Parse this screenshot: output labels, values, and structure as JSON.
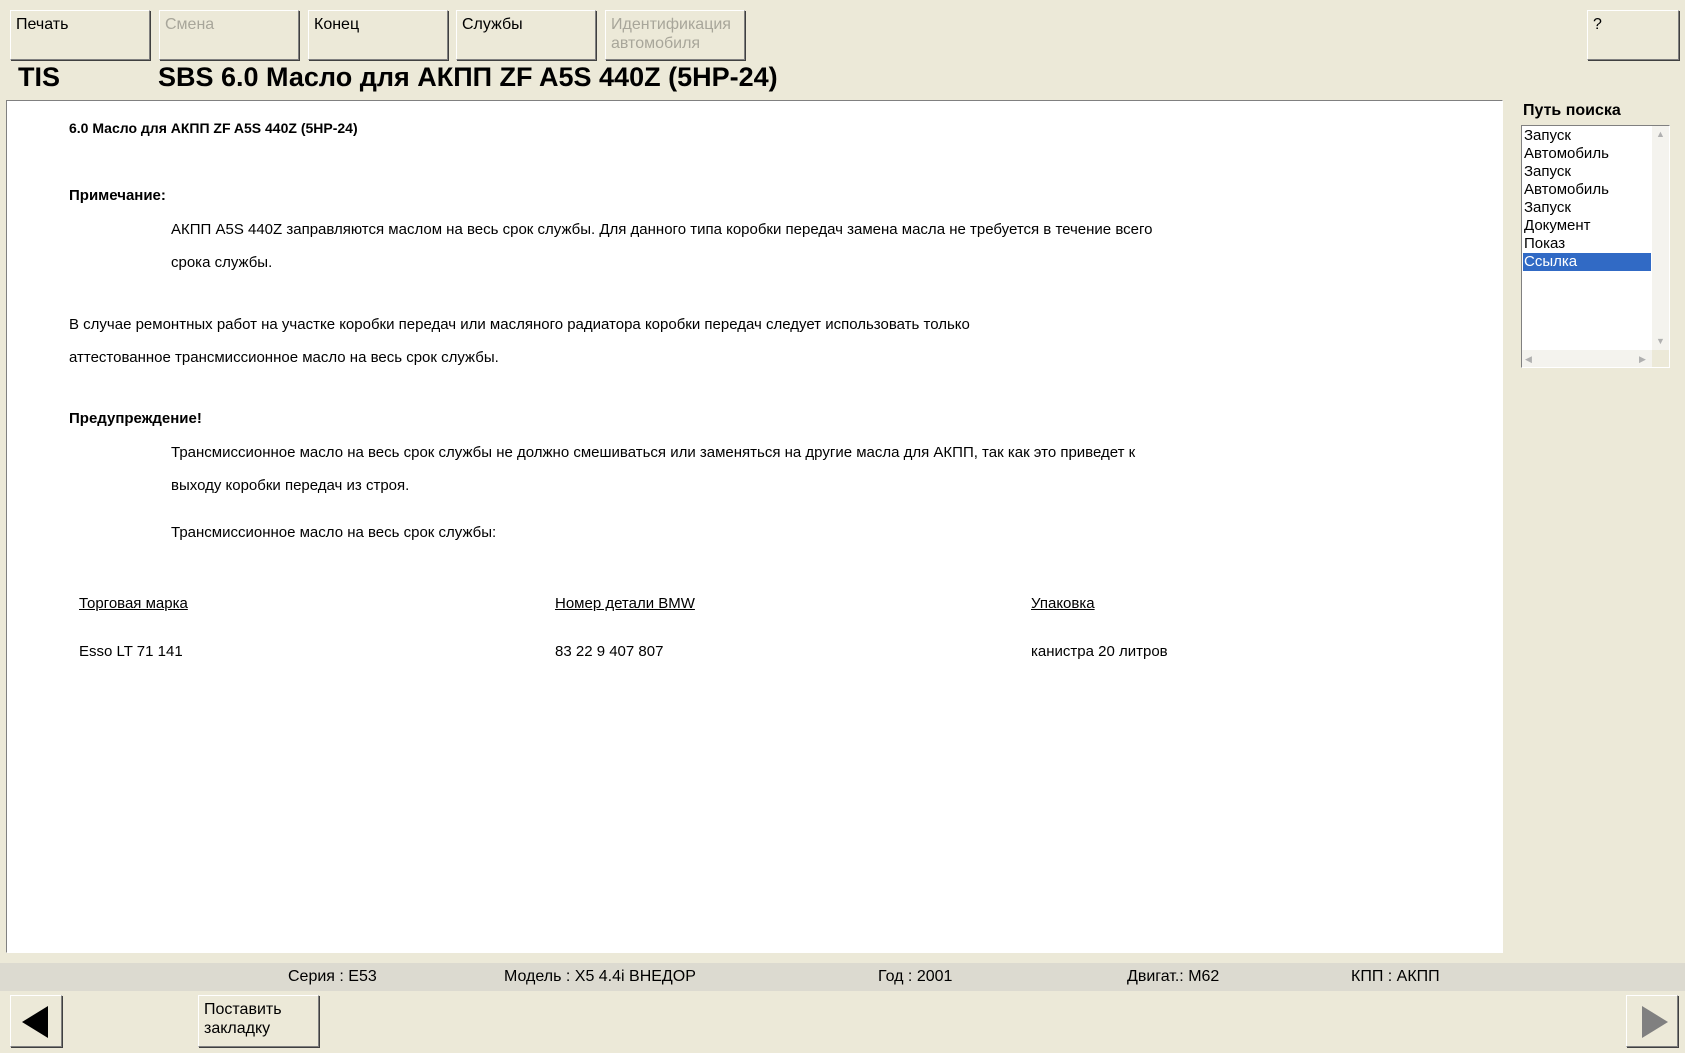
{
  "toolbar": {
    "print": "Печать",
    "change": "Смена",
    "end": "Конец",
    "services": "Службы",
    "vehicle_id_line1": "Идентификация",
    "vehicle_id_line2": "автомобиля",
    "help": "?"
  },
  "header": {
    "app": "TIS",
    "page_title": "SBS  6.0 Масло для АКПП ZF A5S 440Z (5HP-24)"
  },
  "document": {
    "title": "6.0 Масло для АКПП ZF A5S 440Z (5HP-24)",
    "note_label": "Примечание:",
    "note_line1": "АКПП A5S 440Z заправляются маслом на весь срок службы. Для данного типа коробки передач замена масла не требуется в течение всего",
    "note_line2": "срока службы.",
    "repair_line1": "В случае ремонтных работ на участке коробки передач или масляного радиатора коробки передач следует использовать только",
    "repair_line2": "аттестованное трансмиссионное масло на весь срок службы.",
    "warning_label": "Предупреждение!",
    "warning_line1": "Трансмиссионное масло на весь срок службы не должно смешиваться или заменяться на другие масла для АКПП, так как это приведет к",
    "warning_line2": "выходу коробки передач из строя.",
    "lifetime_oil": "Трансмиссионное масло на весь срок службы:",
    "table": {
      "headers": [
        "Торговая марка",
        "Номер детали BMW",
        "Упаковка"
      ],
      "row": [
        "Esso LT 71 141",
        "83 22 9 407 807",
        "канистра 20 литров"
      ]
    }
  },
  "search_path": {
    "label": "Путь поиска",
    "items": [
      "Запуск",
      "Автомобиль",
      "Запуск",
      "Автомобиль",
      "Запуск",
      "Документ",
      "Показ",
      "Ссылка"
    ],
    "selected_index": 7
  },
  "status_bar": {
    "series": "Серия : E53",
    "model": "Модель : X5 4.4i ВНЕДОР",
    "year": "Год : 2001",
    "engine": "Двигат.: M62",
    "gearbox": "КПП : АКПП"
  },
  "bottom": {
    "bookmark_line1": "Поставить",
    "bookmark_line2": "закладку"
  },
  "colors": {
    "background": "#ECE9D8",
    "selection": "#316AC5",
    "status_bar": "#DCDAD0"
  }
}
